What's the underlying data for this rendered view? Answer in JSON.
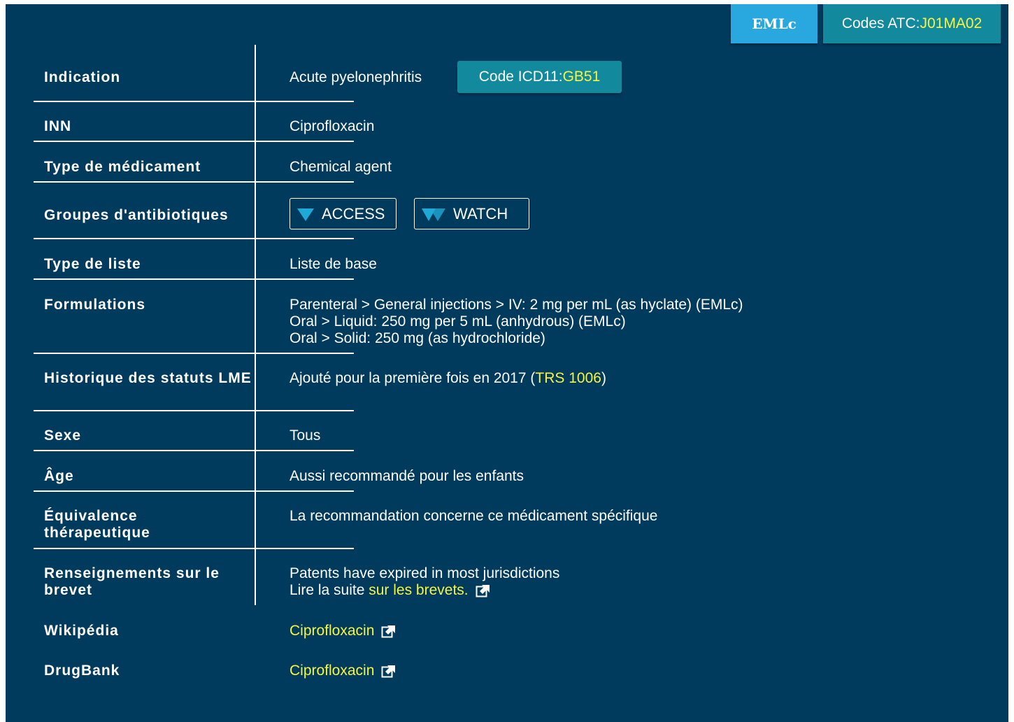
{
  "header": {
    "eml_badge": "EMLc",
    "atc_prefix": "Codes ATC: ",
    "atc_code": "J01MA02"
  },
  "rows": {
    "indication": {
      "label": "Indication",
      "value": "Acute pyelonephritis",
      "icd_prefix": "Code ICD11: ",
      "icd_code": "GB51"
    },
    "inn": {
      "label": "INN",
      "value": "Ciprofloxacin"
    },
    "med_type": {
      "label": "Type de médicament",
      "value": "Chemical agent"
    },
    "antibiotic_groups": {
      "label": "Groupes d'antibiotiques",
      "access": "ACCESS",
      "watch": "WATCH"
    },
    "list_type": {
      "label": "Type de liste",
      "value": "Liste de base"
    },
    "formulations": {
      "label": "Formulations",
      "lines": [
        "Parenteral > General injections > IV: 2 mg per mL (as hyclate) (EMLc)",
        "Oral > Liquid: 250 mg per 5 mL (anhydrous) (EMLc)",
        "Oral > Solid: 250 mg (as hydrochloride)"
      ]
    },
    "status_history": {
      "label": "Historique des statuts LME",
      "value_prefix": "Ajouté pour la première fois en 2017 (",
      "link": "TRS 1006",
      "value_suffix": ")"
    },
    "sex": {
      "label": "Sexe",
      "value": "Tous"
    },
    "age": {
      "label": "Âge",
      "value": "Aussi recommandé pour les enfants"
    },
    "therapeutic_equivalence": {
      "label": "Équivalence thérapeutique",
      "value": "La recommandation concerne ce médicament spécifique"
    },
    "patent_info": {
      "label": "Renseignements sur le brevet",
      "line1": "Patents have expired in most jurisdictions",
      "line2_prefix": "Lire la suite ",
      "link": "sur les brevets."
    },
    "wikipedia": {
      "label": "Wikipédia",
      "link": "Ciprofloxacin"
    },
    "drugbank": {
      "label": "DrugBank",
      "link": "Ciprofloxacin"
    }
  },
  "colors": {
    "background": "#003a5d",
    "eml_badge": "#29a8e0",
    "teal_badge": "#12899c",
    "link": "#f5f542",
    "access_icon": "#1fa9d6"
  },
  "icons": {
    "access": "triangle-down-icon",
    "watch": "double-triangle-icon",
    "external": "external-link-icon"
  }
}
